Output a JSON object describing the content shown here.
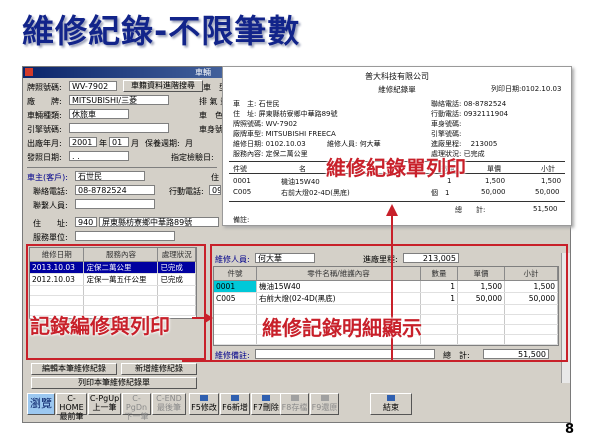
{
  "slide": {
    "title": "維修紀錄-不限筆數",
    "page_number": "8"
  },
  "window": {
    "title": "車輛"
  },
  "vehicle": {
    "plate_label": "牌照號碼:",
    "plate_value": "WV-7902",
    "lookup_button": "車籍資料進階搜尋",
    "brand_label": "廠　　牌:",
    "brand_value": "MITSUBISHI/三菱",
    "type_label": "車輛種類:",
    "type_value": "休旅車",
    "engine_label": "引擎號碼:",
    "engine_value": "",
    "mfg_label": "出廠年月:",
    "mfg_year": "2001",
    "mfg_year_unit": "年",
    "mfg_month": "01",
    "mfg_month_unit": "月",
    "license_label": "發照日期:",
    "license_value": "  .  .",
    "model_label": "車　型:",
    "cc_label": "排 氣 量:",
    "color_label": "車　色:",
    "body_label": "車身號:",
    "cycle_label": "保養週期:",
    "cycle_unit": "月",
    "reminder_label": "指定檢驗日:"
  },
  "owner": {
    "owner_label": "車主(客戶):",
    "owner_value": "石世民",
    "owner_right_label": "住",
    "phone_label": "聯絡電話:",
    "phone_value": "08-8782524",
    "mobile_label": "行動電話:",
    "mobile_value": "09",
    "contact_label": "聯繫人員:",
    "contact_value": "",
    "addr_label": "住　　址:",
    "addr_zip": "940",
    "addr_value": "屏東縣枋寮鄉中華路89號",
    "service_label": "服務單位:",
    "service_value": ""
  },
  "history": {
    "columns": [
      "維修日期",
      "服務內容",
      "處理狀況"
    ],
    "rows": [
      {
        "date": "2013.10.03",
        "content": "定保二萬公里",
        "status": "已完成"
      },
      {
        "date": "2012.10.03",
        "content": "定保一萬五仟公里",
        "status": "已完成"
      }
    ],
    "edit_button": "編輯本筆維修紀錄",
    "add_button": "新增維修紀錄",
    "print_button": "列印本筆維修紀錄單"
  },
  "detail": {
    "tech_label": "維修人員:",
    "tech_value": "何大華",
    "mileage_label": "進廠里程:",
    "mileage_value": "213,005",
    "columns": [
      "件號",
      "零件名稱/維護內容",
      "數量",
      "單價",
      "小計"
    ],
    "rows": [
      {
        "no": "0001",
        "name": "機油15W40",
        "qty": "1",
        "price": "1,500",
        "subtotal": "1,500"
      },
      {
        "no": "C005",
        "name": "右前大燈(02-4D(黑底)",
        "qty": "1",
        "price": "50,000",
        "subtotal": "50,000"
      }
    ],
    "remark_label": "維修備註:",
    "total_label": "總　計:",
    "total_value": "51,500"
  },
  "toolbar": [
    {
      "label": "瀏覽",
      "hotkey": "",
      "enabled": true
    },
    {
      "label": "最前筆",
      "hotkey": "C-HOME",
      "enabled": true
    },
    {
      "label": "上一筆",
      "hotkey": "C-PgUp",
      "enabled": true
    },
    {
      "label": "下一筆",
      "hotkey": "C-PgDn",
      "enabled": false
    },
    {
      "label": "最後筆",
      "hotkey": "C-END",
      "enabled": false
    },
    {
      "label": "F5修改",
      "hotkey": "",
      "enabled": true
    },
    {
      "label": "F6新增",
      "hotkey": "",
      "enabled": true
    },
    {
      "label": "F7刪除",
      "hotkey": "",
      "enabled": true
    },
    {
      "label": "F8存檔",
      "hotkey": "",
      "enabled": false
    },
    {
      "label": "F9還原",
      "hotkey": "",
      "enabled": false
    },
    {
      "label": "結束",
      "hotkey": "",
      "enabled": true
    }
  ],
  "report": {
    "company": "普大科技有限公司",
    "title": "維修紀錄單",
    "print_date": "列印日期:0102.10.03",
    "owner": "車　主: 石世民",
    "phone": "聯絡電話: 08-8782524",
    "address": "住　址: 屏東縣枋寮鄉中華路89號",
    "mobile": "行動電話: 0932111904",
    "plate": "牌照號碼: WV-7902",
    "body_no": "車身號碼:",
    "brand": "廠牌車型: MITSUBISHI FREECA",
    "engine_no": "引擎號碼:",
    "repair_date": "維修日期: 0102.10.03",
    "tech": "維修人員: 何大華",
    "mileage": "進廠里程:　 213005",
    "service": "服務內容: 定保二萬公里",
    "status": "處理狀況: 已完成",
    "columns": [
      "件號",
      "名",
      "稱",
      "數量",
      "單價",
      "小計"
    ],
    "rows": [
      {
        "no": "0001",
        "name": "機油15W40",
        "unit": "1",
        "price": "1,500",
        "subtotal": "1,500"
      },
      {
        "no": "C005",
        "name": "右前大燈02-4D(黑底)",
        "unit": "個　1",
        "price": "50,000",
        "subtotal": "50,000"
      }
    ],
    "total_label": "總　　計:",
    "total_value": "51,500",
    "remark_label": "備註:"
  },
  "callouts": {
    "print_sheet": "維修紀錄單列印",
    "edit_print": "記錄編修與列印",
    "detail_display": "維修記錄明細顯示"
  },
  "colors": {
    "callout_red": "#c8202a",
    "title_blue": "#12248a",
    "selection_blue": "#0000a0",
    "selection_cyan": "#00c8d8"
  }
}
